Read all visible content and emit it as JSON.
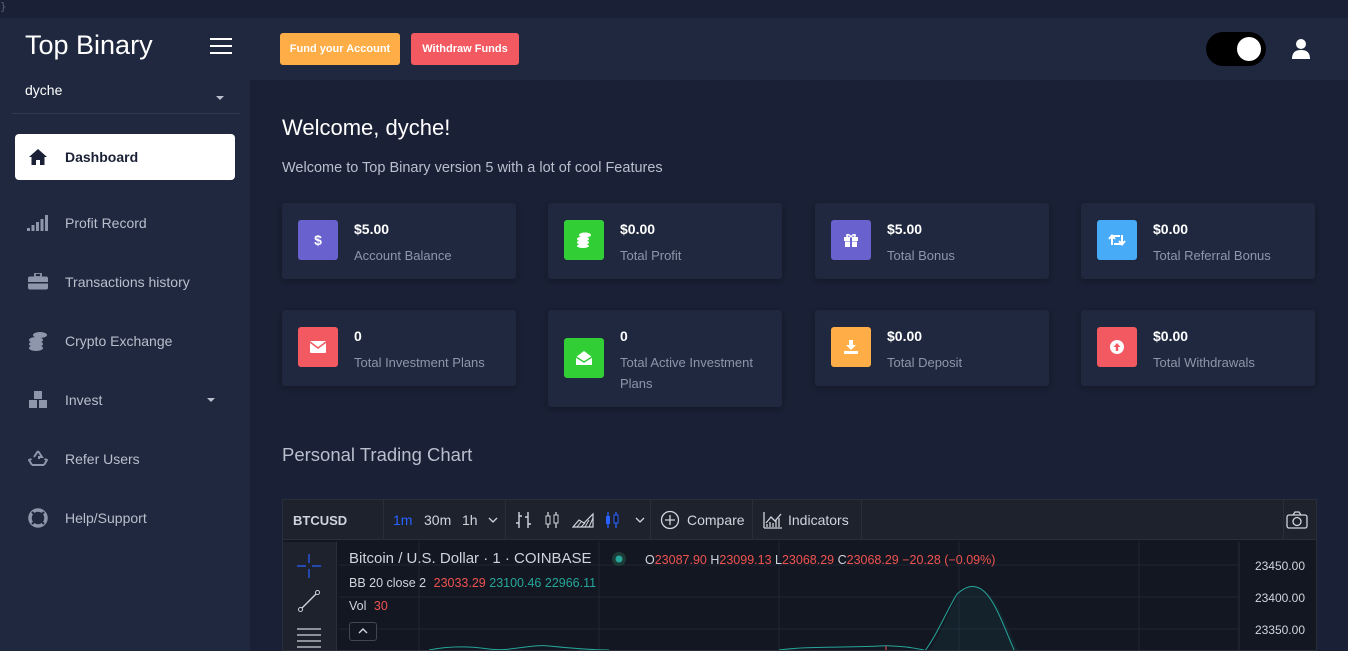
{
  "stray_char": "}",
  "sidebar": {
    "brand": "Top Binary",
    "username": "dyche",
    "items": [
      {
        "label": "Dashboard",
        "icon": "home-icon",
        "active": true
      },
      {
        "label": "Profit Record",
        "icon": "signal-bars-icon"
      },
      {
        "label": "Transactions history",
        "icon": "briefcase-icon"
      },
      {
        "label": "Crypto Exchange",
        "icon": "coins-icon"
      },
      {
        "label": "Invest",
        "icon": "cubes-icon",
        "has_dropdown": true
      },
      {
        "label": "Refer Users",
        "icon": "recycle-icon"
      },
      {
        "label": "Help/Support",
        "icon": "life-ring-icon"
      }
    ]
  },
  "header": {
    "fund_label": "Fund your Account",
    "withdraw_label": "Withdraw Funds",
    "colors": {
      "fund": "#ffad46",
      "withdraw": "#f25961"
    }
  },
  "main": {
    "welcome": "Welcome, dyche!",
    "subtitle": "Welcome to Top Binary version 5 with a lot of cool Features",
    "cards": [
      {
        "value": "$5.00",
        "label": "Account Balance",
        "icon": "dollar-icon",
        "color": "#6861ce"
      },
      {
        "value": "$0.00",
        "label": "Total Profit",
        "icon": "coins-icon",
        "color": "#31ce36"
      },
      {
        "value": "$5.00",
        "label": "Total Bonus",
        "icon": "gift-icon",
        "color": "#6861ce"
      },
      {
        "value": "$0.00",
        "label": "Total Referral Bonus",
        "icon": "retweet-icon",
        "color": "#48abf7"
      },
      {
        "value": "0",
        "label": "Total Investment Plans",
        "icon": "envelope-icon",
        "color": "#f25961"
      },
      {
        "value": "0",
        "label": "Total Active Investment Plans",
        "icon": "envelope-open-icon",
        "color": "#31ce36"
      },
      {
        "value": "$0.00",
        "label": "Total Deposit",
        "icon": "download-icon",
        "color": "#ffad46"
      },
      {
        "value": "$0.00",
        "label": "Total Withdrawals",
        "icon": "arrow-up-circle-icon",
        "color": "#f25961"
      }
    ],
    "chart_section_title": "Personal Trading Chart"
  },
  "trading_chart": {
    "symbol": "BTCUSD",
    "intervals": [
      "1m",
      "30m",
      "1h"
    ],
    "active_interval": "1m",
    "compare_label": "Compare",
    "indicators_label": "Indicators",
    "instrument": "Bitcoin / U.S. Dollar · 1 · COINBASE",
    "ohlc": {
      "o_label": "O",
      "o": "23087.90",
      "h_label": "H",
      "h": "23099.13",
      "l_label": "L",
      "l": "23068.29",
      "c_label": "C",
      "c": "23068.29",
      "change": "−20.28 (−0.09%)"
    },
    "bb_label": "BB 20 close 2",
    "bb_values": [
      "23033.29",
      "23100.46",
      "22966.11"
    ],
    "vol_label": "Vol",
    "vol_value": "30",
    "price_ticks": [
      "23450.00",
      "23400.00",
      "23350.00"
    ],
    "colors": {
      "up": "#26a69a",
      "down": "#ef5350"
    }
  }
}
